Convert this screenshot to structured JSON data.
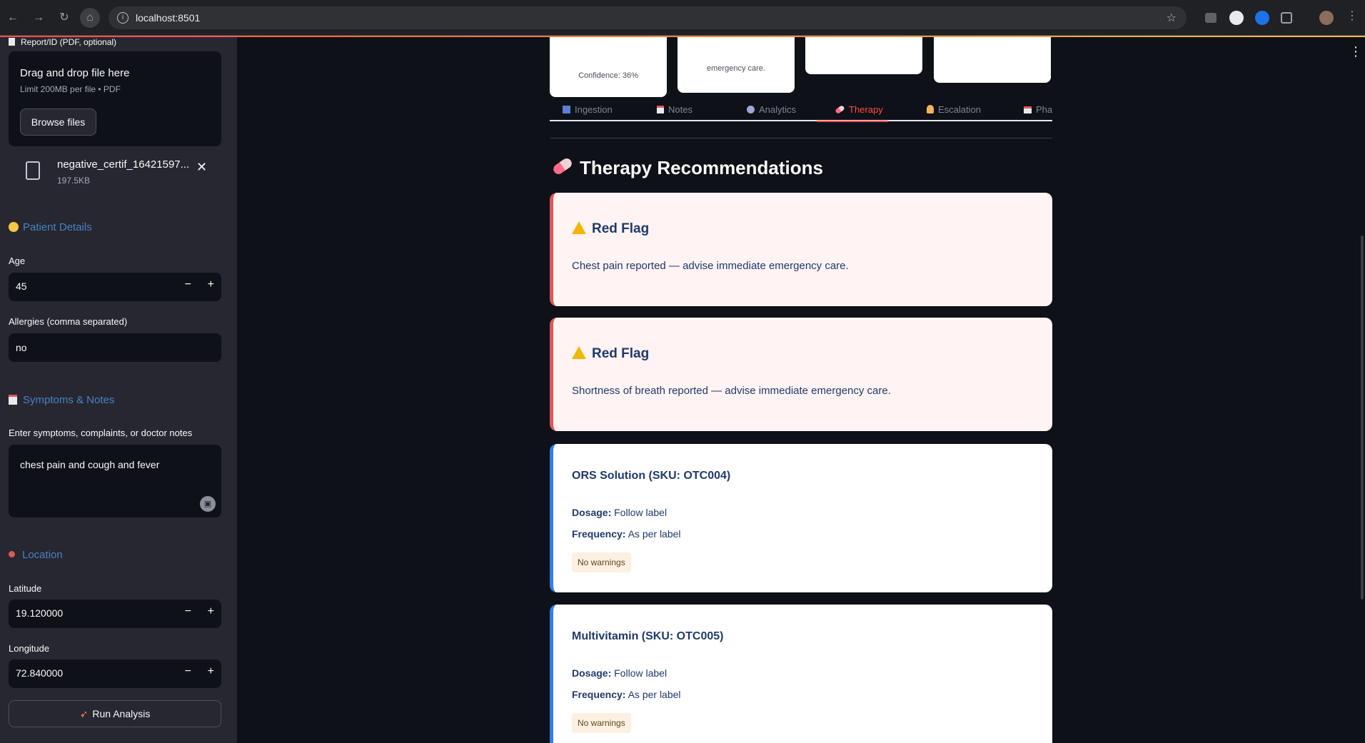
{
  "browser": {
    "url": "localhost:8501",
    "icons": [
      "back-icon",
      "forward-icon",
      "reload-icon",
      "home-icon",
      "info-icon",
      "star-icon",
      "extensions-icon",
      "profile-icon",
      "menu-icon"
    ]
  },
  "sidebar": {
    "upload_caption": "Report/ID (PDF, optional)",
    "uploader": {
      "title": "Drag and drop file here",
      "limit": "Limit 200MB per file • PDF",
      "browse_label": "Browse files"
    },
    "file": {
      "name": "negative_certif_16421597...",
      "size": "197.5KB"
    },
    "patient_details": {
      "heading": "Patient Details",
      "age_label": "Age",
      "age_value": "45",
      "allergies_label": "Allergies (comma separated)",
      "allergies_value": "no"
    },
    "symptoms": {
      "heading": "Symptoms & Notes",
      "label": "Enter symptoms, complaints, or doctor notes",
      "value": "chest pain and cough and fever"
    },
    "location": {
      "heading": "Location",
      "latitude_label": "Latitude",
      "latitude_value": "19.120000",
      "longitude_label": "Longitude",
      "longitude_value": "72.840000"
    },
    "run_label": "Run Analysis"
  },
  "main": {
    "metric_cards": [
      {
        "text": "Confidence: 36%"
      },
      {
        "text": "emergency care."
      },
      {
        "text": ""
      },
      {
        "text": ""
      }
    ],
    "tabs": [
      {
        "label": "Ingestion",
        "icon": "inbox-icon"
      },
      {
        "label": "Notes",
        "icon": "notes-icon"
      },
      {
        "label": "Analytics",
        "icon": "analytics-icon"
      },
      {
        "label": "Therapy",
        "icon": "pill-icon",
        "active": true
      },
      {
        "label": "Escalation",
        "icon": "doctor-icon"
      },
      {
        "label": "Pha",
        "icon": "pharmacy-icon"
      }
    ],
    "section_title": "Therapy Recommendations",
    "red_flags": [
      {
        "title": "Red Flag",
        "text": "Chest pain reported — advise immediate emergency care."
      },
      {
        "title": "Red Flag",
        "text": "Shortness of breath reported — advise immediate emergency care."
      }
    ],
    "medications": [
      {
        "title": "ORS Solution (SKU: OTC004)",
        "dosage_key": "Dosage:",
        "dosage": "Follow label",
        "frequency_key": "Frequency:",
        "frequency": "As per label",
        "warning": "No warnings"
      },
      {
        "title": "Multivitamin (SKU: OTC005)",
        "dosage_key": "Dosage:",
        "dosage": "Follow label",
        "frequency_key": "Frequency:",
        "frequency": "As per label",
        "warning": "No warnings"
      }
    ]
  },
  "colors": {
    "background": "#0e1117",
    "sidebar": "#262730",
    "accent": "#ff4b4b",
    "heading_blue": "#4a82c4",
    "flag_bg": "#fff3f3",
    "flag_border": "#e15759",
    "med_border": "#2f80ed"
  }
}
